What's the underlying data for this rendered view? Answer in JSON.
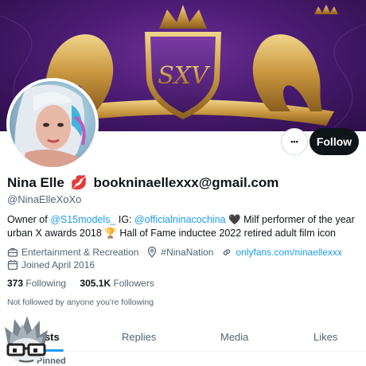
{
  "profile": {
    "display_name": "Nina Elle",
    "name_emoji": "💋",
    "name_suffix": "bookninaellexxx@gmail.com",
    "handle": "@NinaElleXoXo"
  },
  "banner": {
    "monogram": "SXV"
  },
  "actions": {
    "more_label": "•••",
    "follow_label": "Follow"
  },
  "bio": {
    "prefix": "Owner of ",
    "mention1": "@S15models_",
    "mid": " IG: ",
    "mention2": "@officialninacochina",
    "rest": " 🖤 Milf performer of the year urban X awards 2018 🏆 Hall of Fame inductee 2022 retired adult film icon"
  },
  "meta": {
    "category": "Entertainment & Recreation",
    "location": "#NinaNation",
    "website": "onlyfans.com/ninaellexxx",
    "joined": "Joined April 2016"
  },
  "counts": {
    "following_num": "373",
    "following_label": "Following",
    "followers_num": "305.1K",
    "followers_label": "Followers"
  },
  "not_followed": "Not followed by anyone you're following",
  "tabs": [
    {
      "label": "osts"
    },
    {
      "label": "Replies"
    },
    {
      "label": "Media"
    },
    {
      "label": "Likes"
    }
  ],
  "pinned_label": "Pinned",
  "colors": {
    "accent": "#1d9bf0",
    "banner": "#4b1c73",
    "gold": "#d8b25a"
  }
}
